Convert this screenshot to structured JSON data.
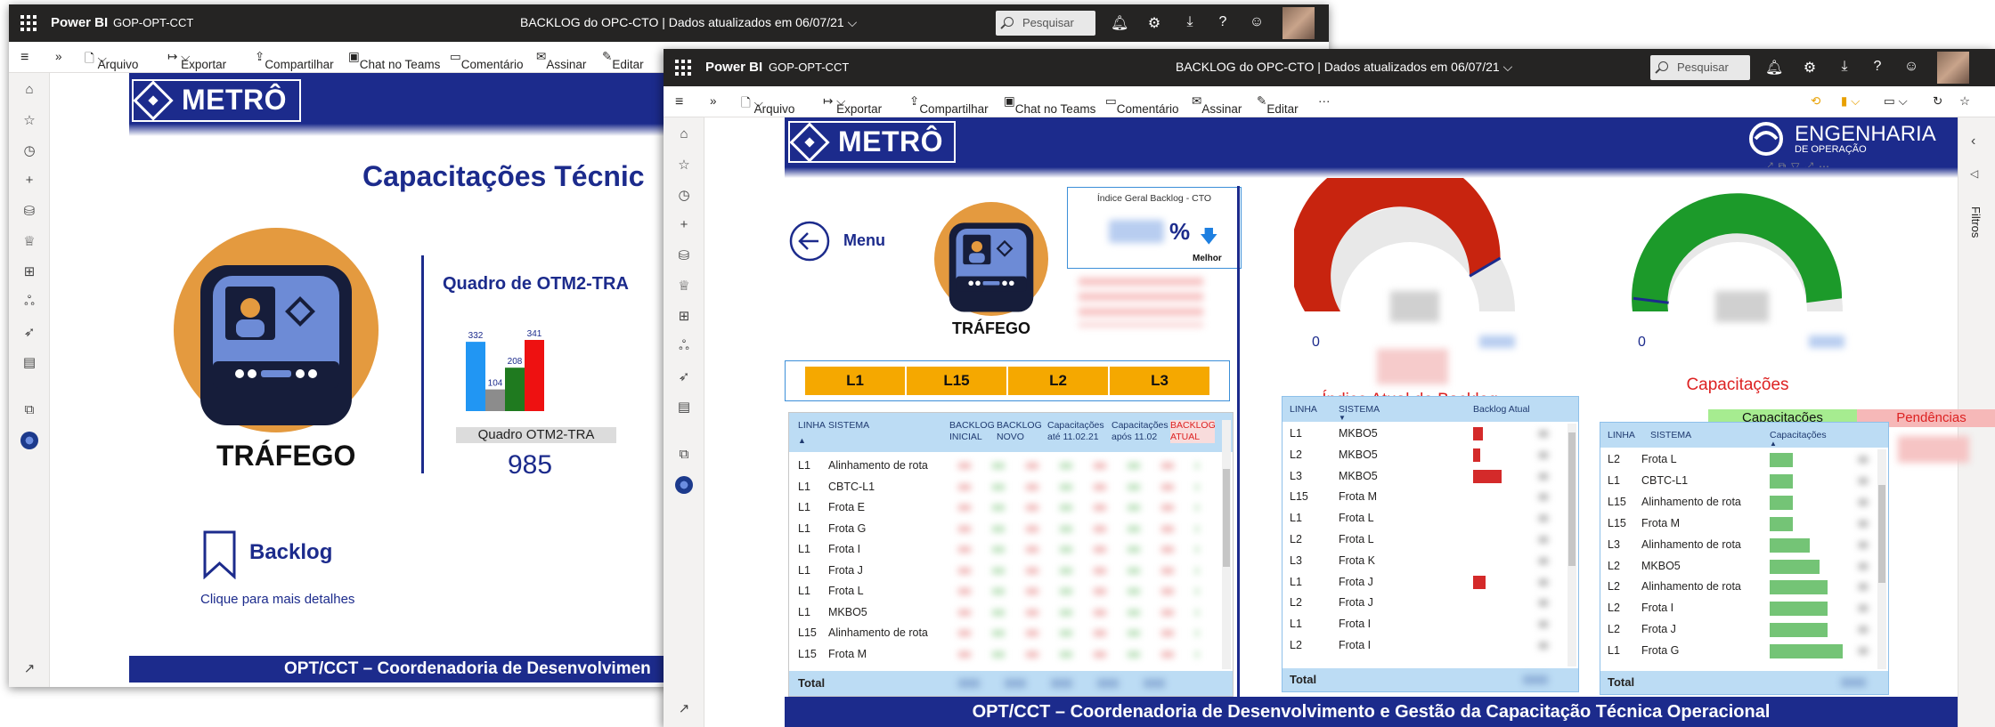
{
  "topbar": {
    "brand": "Power BI",
    "workspace": "GOP-OPT-CCT",
    "title": "BACKLOG do OPC-CTO",
    "updated": "Dados atualizados em 06/07/21",
    "search_placeholder": "Pesquisar"
  },
  "actionbar": {
    "file": "Arquivo",
    "export": "Exportar",
    "share": "Compartilhar",
    "teams": "Chat no Teams",
    "comment": "Comentário",
    "subscribe": "Assinar",
    "edit": "Editar",
    "more": "···"
  },
  "right_panel": {
    "filters": "Filtros"
  },
  "back_report": {
    "logo": "METRÔ",
    "title": "Capacitações Técnic",
    "traffic_label": "TRÁFEGO",
    "chart_title": "Quadro de OTM2-TRA",
    "chart_caption": "Quadro OTM2-TRA",
    "chart_total": "985",
    "backlog_label": "Backlog",
    "details_hint": "Clique para mais detalhes",
    "footer": "OPT/CCT – Coordenadoria de Desenvolvimen"
  },
  "chart_data": {
    "type": "bar",
    "title": "Quadro de OTM2-TRA",
    "categories": [
      "",
      "",
      "",
      ""
    ],
    "values": [
      332,
      104,
      208,
      341
    ],
    "colors": [
      "#2196f3",
      "#8c8c8c",
      "#1f7a1f",
      "#ee1111"
    ]
  },
  "front_report": {
    "logo": "METRÔ",
    "eng_title": "ENGENHARIA",
    "eng_sub": "DE OPERAÇÃO",
    "menu_label": "Menu",
    "traffic_label": "TRÁFEGO",
    "kpi_title": "Índice Geral Backlog - CTO",
    "kpi_unit": "%",
    "kpi_better": "Melhor",
    "line_buttons": [
      "L1",
      "L15",
      "L2",
      "L3"
    ],
    "gauge1_min": "0",
    "gauge2_min": "0",
    "gauge1_title": "Índice Atual de Backlog",
    "gauge2_title": "Capacitações",
    "tab_capacitacoes": "Capacitações",
    "tab_pendencias": "Pendências",
    "footer": "OPT/CCT – Coordenadoria de Desenvolvimento e Gestão da Capacitação Técnica Operacional"
  },
  "table1": {
    "headers": [
      "LINHA",
      "SISTEMA",
      "BACKLOG INICIAL",
      "BACKLOG NOVO",
      "Capacitações até 11.02.21",
      "Capacitações após 11.02",
      "BACKLOG ATUAL"
    ],
    "rows": [
      [
        "L1",
        "Alinhamento de rota"
      ],
      [
        "L1",
        "CBTC-L1"
      ],
      [
        "L1",
        "Frota E"
      ],
      [
        "L1",
        "Frota G"
      ],
      [
        "L1",
        "Frota I"
      ],
      [
        "L1",
        "Frota J"
      ],
      [
        "L1",
        "Frota L"
      ],
      [
        "L1",
        "MKBO5"
      ],
      [
        "L15",
        "Alinhamento de rota"
      ],
      [
        "L15",
        "Frota M"
      ]
    ],
    "total_label": "Total"
  },
  "table2": {
    "headers": [
      "LINHA",
      "SISTEMA",
      "Backlog Atual"
    ],
    "rows": [
      [
        "L1",
        "MKBO5"
      ],
      [
        "L2",
        "MKBO5"
      ],
      [
        "L3",
        "MKBO5"
      ],
      [
        "L15",
        "Frota M"
      ],
      [
        "L1",
        "Frota L"
      ],
      [
        "L2",
        "Frota L"
      ],
      [
        "L3",
        "Frota K"
      ],
      [
        "L1",
        "Frota J"
      ],
      [
        "L2",
        "Frota J"
      ],
      [
        "L1",
        "Frota I"
      ],
      [
        "L2",
        "Frota I"
      ]
    ],
    "total_label": "Total"
  },
  "table3": {
    "headers": [
      "LINHA",
      "SISTEMA",
      "Capacitações"
    ],
    "rows": [
      [
        "L2",
        "Frota L"
      ],
      [
        "L1",
        "CBTC-L1"
      ],
      [
        "L15",
        "Alinhamento de rota"
      ],
      [
        "L15",
        "Frota M"
      ],
      [
        "L3",
        "Alinhamento de rota"
      ],
      [
        "L2",
        "MKBO5"
      ],
      [
        "L2",
        "Alinhamento de rota"
      ],
      [
        "L2",
        "Frota I"
      ],
      [
        "L2",
        "Frota J"
      ],
      [
        "L1",
        "Frota G"
      ]
    ],
    "total_label": "Total"
  }
}
